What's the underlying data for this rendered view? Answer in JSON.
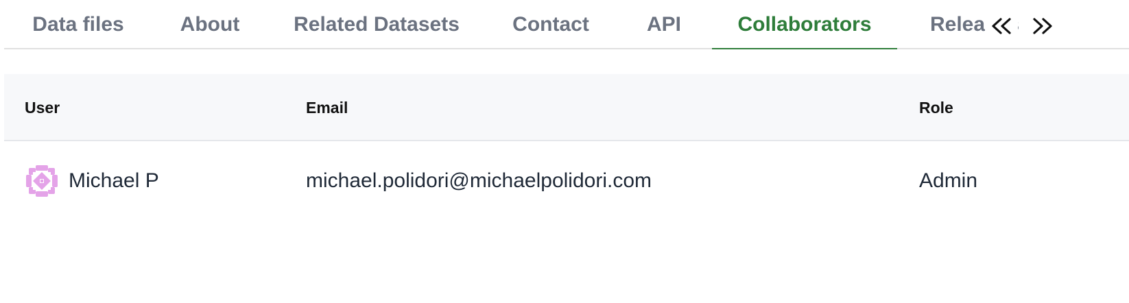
{
  "tabs": {
    "items": [
      {
        "label": "Data files",
        "active": false
      },
      {
        "label": "About",
        "active": false
      },
      {
        "label": "Related Datasets",
        "active": false
      },
      {
        "label": "Contact",
        "active": false
      },
      {
        "label": "API",
        "active": false
      },
      {
        "label": "Collaborators",
        "active": true
      },
      {
        "label": "Releases",
        "active": false
      }
    ],
    "scroll_left_icon": "chevron-double-left-icon",
    "scroll_right_icon": "chevron-double-right-icon"
  },
  "colors": {
    "active_tab": "#2e7d3a",
    "inactive_tab": "#6b7280",
    "header_bg": "#f7f8fa",
    "avatar": "#e4a3e8"
  },
  "table": {
    "headers": {
      "user": "User",
      "email": "Email",
      "role": "Role"
    },
    "rows": [
      {
        "avatar_icon": "identicon-avatar",
        "user": "Michael P",
        "email": "michael.polidori@michaelpolidori.com",
        "role": "Admin"
      }
    ]
  }
}
